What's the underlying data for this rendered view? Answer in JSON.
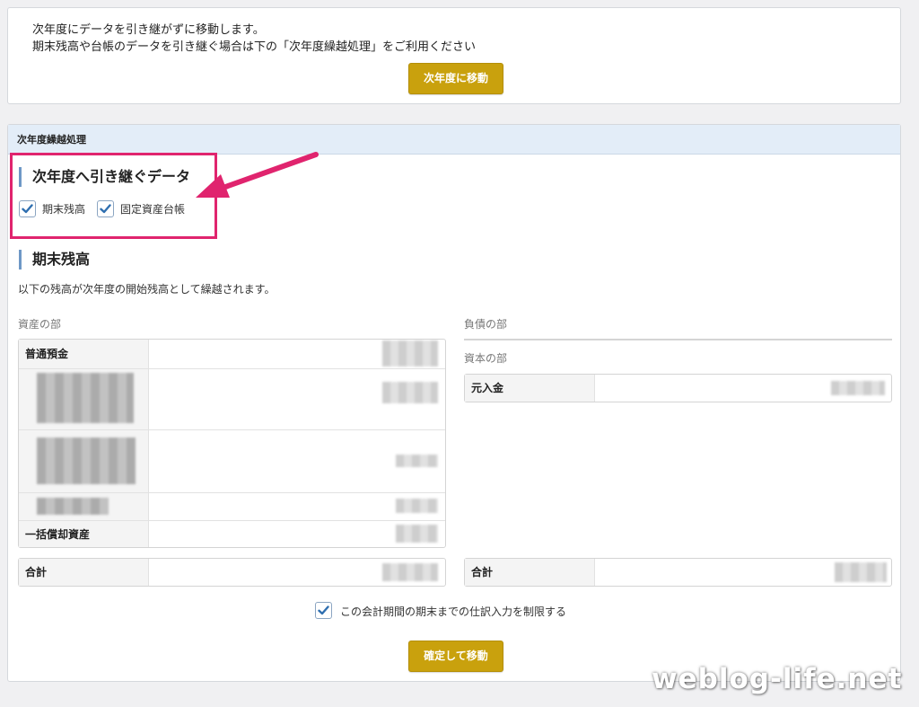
{
  "move_panel": {
    "line1": "次年度にデータを引き継がずに移動します。",
    "line2": "期末残高や台帳のデータを引き継ぐ場合は下の「次年度繰越処理」をご利用ください",
    "move_button": "次年度に移動"
  },
  "carry_panel": {
    "header": "次年度繰越処理",
    "carry_title": "次年度へ引き継ぐデータ",
    "options": [
      {
        "label": "期末残高",
        "checked": true
      },
      {
        "label": "固定資産台帳",
        "checked": true
      }
    ],
    "balance_title": "期末残高",
    "note": "以下の残高が次年度の開始残高として繰越されます。",
    "assets": {
      "heading": "資産の部",
      "rows": [
        "普通預金",
        "一括償却資産"
      ],
      "total_label": "合計"
    },
    "liabilities": {
      "heading": "負債の部"
    },
    "equity": {
      "heading": "資本の部",
      "rows": [
        "元入金"
      ],
      "total_label": "合計"
    },
    "restrict_label": "この会計期間の期末までの仕訳入力を制限する",
    "confirm_button": "確定して移動"
  },
  "watermark": "weblog-life.net",
  "colors": {
    "accent_gold": "#c9a10d",
    "highlight_pink": "#e0246e",
    "header_blue": "#e3edf8",
    "check_blue": "#2f6fb0"
  }
}
